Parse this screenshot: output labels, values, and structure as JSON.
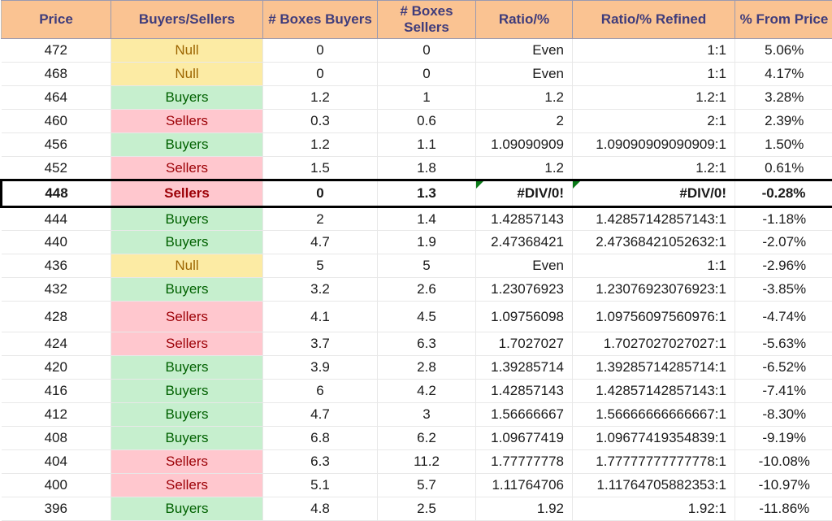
{
  "table": {
    "columns": [
      {
        "key": "price",
        "label": "Price"
      },
      {
        "key": "bs",
        "label": "Buyers/Sellers"
      },
      {
        "key": "boxes_b",
        "label": "# Boxes Buyers"
      },
      {
        "key": "boxes_s",
        "label": "# Boxes Sellers"
      },
      {
        "key": "ratio",
        "label": "Ratio/%"
      },
      {
        "key": "refined",
        "label": "Ratio/% Refined"
      },
      {
        "key": "from",
        "label": "% From Price"
      }
    ],
    "header_colors": {
      "fill": "#FAC392",
      "text": "#3F3C7B",
      "border": "#9A9AB0"
    },
    "status_colors": {
      "null_fill": "#FCEBA4",
      "null_text": "#9C6500",
      "buyers_fill": "#C6EFCE",
      "buyers_text": "#006100",
      "sellers_fill": "#FFC7CE",
      "sellers_text": "#9C0006",
      "error_marker": "#0A7A18",
      "highlight_border": "#000000"
    },
    "rows": [
      {
        "price": "472",
        "bs": "Null",
        "status": "null",
        "boxes_b": "0",
        "boxes_s": "0",
        "ratio": "Even",
        "refined": "1:1",
        "from": "5.06%",
        "highlight": false,
        "error": false,
        "tall": false
      },
      {
        "price": "468",
        "bs": "Null",
        "status": "null",
        "boxes_b": "0",
        "boxes_s": "0",
        "ratio": "Even",
        "refined": "1:1",
        "from": "4.17%",
        "highlight": false,
        "error": false,
        "tall": false
      },
      {
        "price": "464",
        "bs": "Buyers",
        "status": "buyers",
        "boxes_b": "1.2",
        "boxes_s": "1",
        "ratio": "1.2",
        "refined": "1.2:1",
        "from": "3.28%",
        "highlight": false,
        "error": false,
        "tall": false
      },
      {
        "price": "460",
        "bs": "Sellers",
        "status": "sellers",
        "boxes_b": "0.3",
        "boxes_s": "0.6",
        "ratio": "2",
        "refined": "2:1",
        "from": "2.39%",
        "highlight": false,
        "error": false,
        "tall": false
      },
      {
        "price": "456",
        "bs": "Buyers",
        "status": "buyers",
        "boxes_b": "1.2",
        "boxes_s": "1.1",
        "ratio": "1.09090909",
        "refined": "1.09090909090909:1",
        "from": "1.50%",
        "highlight": false,
        "error": false,
        "tall": false
      },
      {
        "price": "452",
        "bs": "Sellers",
        "status": "sellers",
        "boxes_b": "1.5",
        "boxes_s": "1.8",
        "ratio": "1.2",
        "refined": "1.2:1",
        "from": "0.61%",
        "highlight": false,
        "error": false,
        "tall": false
      },
      {
        "price": "448",
        "bs": "Sellers",
        "status": "sellers",
        "boxes_b": "0",
        "boxes_s": "1.3",
        "ratio": "#DIV/0!",
        "refined": "#DIV/0!",
        "from": "-0.28%",
        "highlight": true,
        "error": true,
        "tall": false
      },
      {
        "price": "444",
        "bs": "Buyers",
        "status": "buyers",
        "boxes_b": "2",
        "boxes_s": "1.4",
        "ratio": "1.42857143",
        "refined": "1.42857142857143:1",
        "from": "-1.18%",
        "highlight": false,
        "error": false,
        "tall": false
      },
      {
        "price": "440",
        "bs": "Buyers",
        "status": "buyers",
        "boxes_b": "4.7",
        "boxes_s": "1.9",
        "ratio": "2.47368421",
        "refined": "2.47368421052632:1",
        "from": "-2.07%",
        "highlight": false,
        "error": false,
        "tall": false
      },
      {
        "price": "436",
        "bs": "Null",
        "status": "null",
        "boxes_b": "5",
        "boxes_s": "5",
        "ratio": "Even",
        "refined": "1:1",
        "from": "-2.96%",
        "highlight": false,
        "error": false,
        "tall": false
      },
      {
        "price": "432",
        "bs": "Buyers",
        "status": "buyers",
        "boxes_b": "3.2",
        "boxes_s": "2.6",
        "ratio": "1.23076923",
        "refined": "1.23076923076923:1",
        "from": "-3.85%",
        "highlight": false,
        "error": false,
        "tall": false
      },
      {
        "price": "428",
        "bs": "Sellers",
        "status": "sellers",
        "boxes_b": "4.1",
        "boxes_s": "4.5",
        "ratio": "1.09756098",
        "refined": "1.09756097560976:1",
        "from": "-4.74%",
        "highlight": false,
        "error": false,
        "tall": true
      },
      {
        "price": "424",
        "bs": "Sellers",
        "status": "sellers",
        "boxes_b": "3.7",
        "boxes_s": "6.3",
        "ratio": "1.7027027",
        "refined": "1.7027027027027:1",
        "from": "-5.63%",
        "highlight": false,
        "error": false,
        "tall": false
      },
      {
        "price": "420",
        "bs": "Buyers",
        "status": "buyers",
        "boxes_b": "3.9",
        "boxes_s": "2.8",
        "ratio": "1.39285714",
        "refined": "1.39285714285714:1",
        "from": "-6.52%",
        "highlight": false,
        "error": false,
        "tall": false
      },
      {
        "price": "416",
        "bs": "Buyers",
        "status": "buyers",
        "boxes_b": "6",
        "boxes_s": "4.2",
        "ratio": "1.42857143",
        "refined": "1.42857142857143:1",
        "from": "-7.41%",
        "highlight": false,
        "error": false,
        "tall": false
      },
      {
        "price": "412",
        "bs": "Buyers",
        "status": "buyers",
        "boxes_b": "4.7",
        "boxes_s": "3",
        "ratio": "1.56666667",
        "refined": "1.56666666666667:1",
        "from": "-8.30%",
        "highlight": false,
        "error": false,
        "tall": false
      },
      {
        "price": "408",
        "bs": "Buyers",
        "status": "buyers",
        "boxes_b": "6.8",
        "boxes_s": "6.2",
        "ratio": "1.09677419",
        "refined": "1.09677419354839:1",
        "from": "-9.19%",
        "highlight": false,
        "error": false,
        "tall": false
      },
      {
        "price": "404",
        "bs": "Sellers",
        "status": "sellers",
        "boxes_b": "6.3",
        "boxes_s": "11.2",
        "ratio": "1.77777778",
        "refined": "1.77777777777778:1",
        "from": "-10.08%",
        "highlight": false,
        "error": false,
        "tall": false
      },
      {
        "price": "400",
        "bs": "Sellers",
        "status": "sellers",
        "boxes_b": "5.1",
        "boxes_s": "5.7",
        "ratio": "1.11764706",
        "refined": "1.11764705882353:1",
        "from": "-10.97%",
        "highlight": false,
        "error": false,
        "tall": false
      },
      {
        "price": "396",
        "bs": "Buyers",
        "status": "buyers",
        "boxes_b": "4.8",
        "boxes_s": "2.5",
        "ratio": "1.92",
        "refined": "1.92:1",
        "from": "-11.86%",
        "highlight": false,
        "error": false,
        "tall": false
      }
    ]
  }
}
